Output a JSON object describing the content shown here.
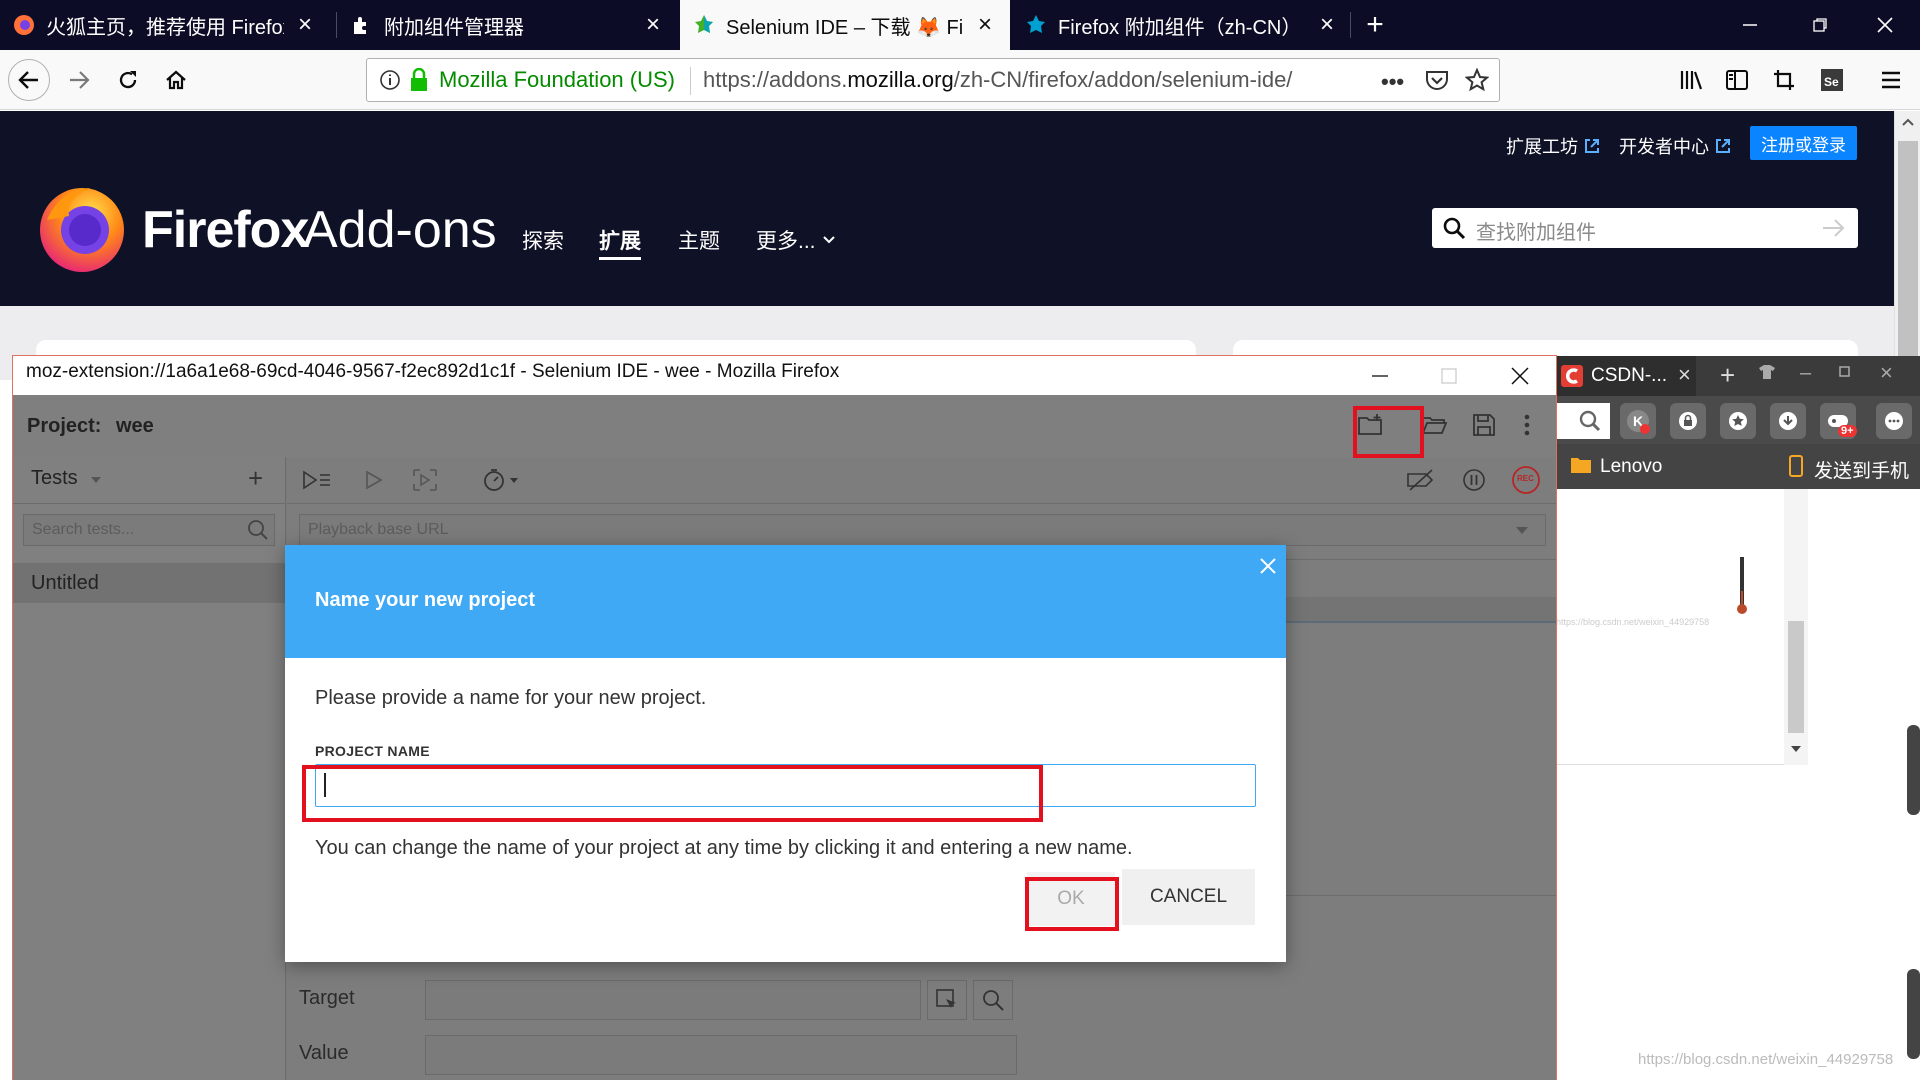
{
  "browser": {
    "tabs": [
      {
        "label": "火狐主页，推荐使用 Firefox 火",
        "icon": "firefox-icon",
        "active": false
      },
      {
        "label": "附加组件管理器",
        "icon": "puzzle-icon",
        "active": false
      },
      {
        "label": "Selenium IDE – 下载 🦊 Firefox",
        "icon": "selenium-icon",
        "active": true
      },
      {
        "label": "Firefox 附加组件（zh-CN）",
        "icon": "selenium-icon",
        "active": false
      }
    ],
    "identity": "Mozilla Foundation (US)",
    "url_prefix": "https://addons.",
    "url_domain": "mozilla.org",
    "url_path": "/zh-CN/firefox/addon/selenium-ide/"
  },
  "amo": {
    "brand_firefox": "Firefox",
    "brand_addons": "Add-ons",
    "top_links": [
      "扩展工坊",
      "开发者中心"
    ],
    "login_label": "注册或登录",
    "nav": [
      "探索",
      "扩展",
      "主题",
      "更多..."
    ],
    "search_placeholder": "查找附加组件"
  },
  "ide": {
    "window_title": "moz-extension://1a6a1e68-69cd-4046-9567-f2ec892d1c1f - Selenium IDE - wee - Mozilla Firefox",
    "project_label": "Project:",
    "project_name": "wee",
    "tests_label": "Tests",
    "search_tests_placeholder": "Search tests...",
    "test_item": "Untitled",
    "base_url_placeholder": "Playback base URL",
    "target_label": "Target",
    "value_label": "Value",
    "rec_label": "REC"
  },
  "modal": {
    "title": "Name your new project",
    "description": "Please provide a name for your new project.",
    "field_label": "PROJECT NAME",
    "field_value": "",
    "hint": "You can change the name of your project at any time by clicking it and entering a new name.",
    "ok_label": "OK",
    "cancel_label": "CANCEL"
  },
  "csdn": {
    "tab_label": "CSDN-...",
    "bookmark_folder": "Lenovo",
    "send_to_phone": "发送到手机",
    "badge": "9+",
    "watermark_small": "https://blog.csdn.net/weixin_44929758",
    "watermark_large": "https://blog.csdn.net/weixin_44929758"
  },
  "colors": {
    "modal_header": "#3fa9f5",
    "annotation_red": "#e3101f",
    "amo_header": "#0f1126",
    "login_blue": "#0a84ff"
  }
}
